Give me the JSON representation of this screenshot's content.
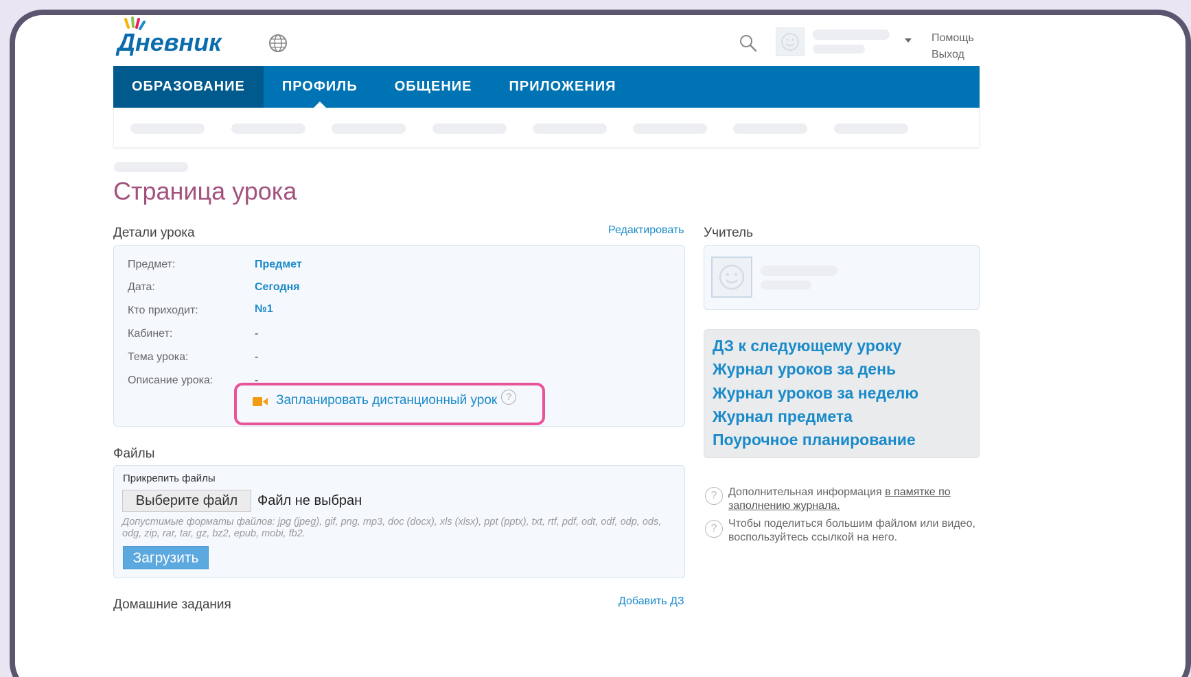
{
  "header": {
    "logo_text": "Дневник",
    "help_label": "Помощь",
    "logout_label": "Выход"
  },
  "nav": {
    "items": [
      {
        "label": "ОБРАЗОВАНИЕ"
      },
      {
        "label": "ПРОФИЛЬ"
      },
      {
        "label": "ОБЩЕНИЕ"
      },
      {
        "label": "ПРИЛОЖЕНИЯ"
      }
    ]
  },
  "page": {
    "title": "Страница урока"
  },
  "details": {
    "heading": "Детали урока",
    "edit_label": "Редактировать",
    "rows": [
      {
        "label": "Предмет:",
        "value": "Предмет"
      },
      {
        "label": "Дата:",
        "value": "Сегодня"
      },
      {
        "label": "Кто приходит:",
        "value": "№1"
      },
      {
        "label": "Кабинет:",
        "value": "-"
      },
      {
        "label": "Тема урока:",
        "value": "-"
      },
      {
        "label": "Описание урока:",
        "value": "-"
      }
    ],
    "remote_lesson_label": "Запланировать дистанционный урок",
    "help_glyph": "?"
  },
  "files": {
    "heading": "Файлы",
    "attach_label": "Прикрепить файлы",
    "choose_button": "Выберите файл",
    "no_file_text": "Файл не выбран",
    "formats_text": "Допустимые форматы файлов: jpg (jpeg), gif, png, mp3, doc (docx), xls (xlsx), ppt (pptx), txt, rtf, pdf, odt, odf, odp, ods, odg, zip, rar, tar, gz, bz2, epub, mobi, fb2.",
    "upload_button": "Загрузить"
  },
  "homework": {
    "heading": "Домашние задания",
    "add_label": "Добавить ДЗ"
  },
  "teacher": {
    "heading": "Учитель"
  },
  "quick_links": [
    {
      "label": "ДЗ к следующему уроку"
    },
    {
      "label": "Журнал уроков за день"
    },
    {
      "label": "Журнал уроков за неделю"
    },
    {
      "label": "Журнал предмета"
    },
    {
      "label": "Поурочное планирование"
    }
  ],
  "info": {
    "note1_text": "Дополнительная информация ",
    "note1_link": "в памятке по заполнению журнала.",
    "note2_text": "Чтобы поделиться большим файлом или видео, воспользуйтесь ссылкой на него.",
    "glyph": "?"
  },
  "colors": {
    "nav_bg": "#0073b4",
    "nav_active_bg": "#005a8e",
    "title": "#a2527d",
    "link": "#1a8ac9",
    "highlight": "#e8549a",
    "frame": "#5b5570"
  }
}
